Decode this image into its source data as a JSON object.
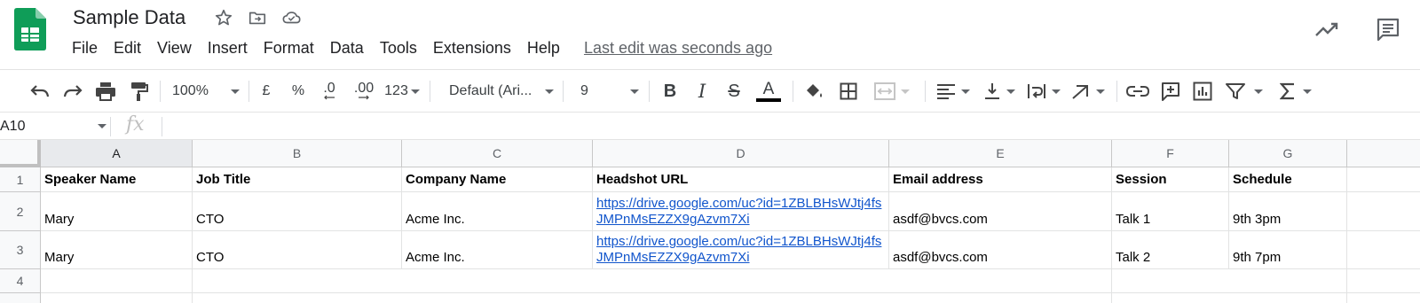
{
  "app": {
    "doc_title": "Sample Data",
    "menu": [
      "File",
      "Edit",
      "View",
      "Insert",
      "Format",
      "Data",
      "Tools",
      "Extensions",
      "Help"
    ],
    "last_edit": "Last edit was seconds ago",
    "brand_color": "#0f9d58"
  },
  "toolbar": {
    "zoom": "100%",
    "currency": "£",
    "percent": "%",
    "dec_decrease": ".0",
    "dec_increase": ".00",
    "more_formats": "123",
    "font": "Default (Ari...",
    "font_size": "9",
    "bold": "B",
    "italic": "I",
    "strike": "S",
    "text_color": "A",
    "text_color_value": "#000000"
  },
  "formula_bar": {
    "cell_ref": "A10",
    "fx": "fx",
    "content": ""
  },
  "sheet": {
    "columns": [
      "A",
      "B",
      "C",
      "D",
      "E",
      "F",
      "G"
    ],
    "rows": [
      "1",
      "2",
      "3",
      "4"
    ],
    "header": [
      "Speaker Name",
      "Job Title",
      "Company Name",
      "Headshot URL",
      "Email address",
      "Session",
      "Schedule"
    ],
    "data": [
      [
        "Mary",
        "CTO",
        "Acme Inc.",
        "https://drive.google.com/uc?id=1ZBLBHsWJtj4fsJMPnMsEZZX9gAzvm7Xi",
        "asdf@bvcs.com",
        "Talk 1",
        "9th 3pm"
      ],
      [
        "Mary",
        "CTO",
        "Acme Inc.",
        "https://drive.google.com/uc?id=1ZBLBHsWJtj4fsJMPnMsEZZX9gAzvm7Xi",
        "asdf@bvcs.com",
        "Talk 2",
        "9th 7pm"
      ]
    ],
    "link_color": "#1155cc"
  }
}
